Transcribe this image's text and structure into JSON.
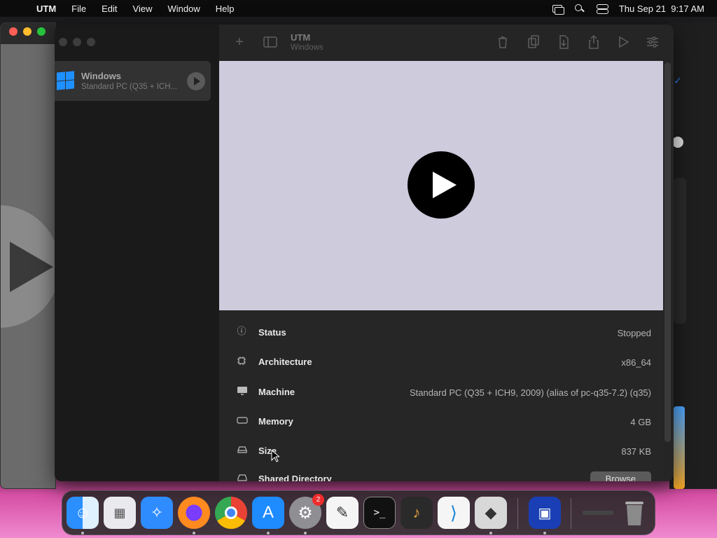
{
  "menubar": {
    "app_name": "UTM",
    "items": [
      "File",
      "Edit",
      "View",
      "Window",
      "Help"
    ],
    "clock": "Thu Sep 21  9:17 AM"
  },
  "sidebar": {
    "vm": {
      "name": "Windows",
      "subtitle": "Standard PC (Q35 + ICH..."
    }
  },
  "toolbar": {
    "title": "UTM",
    "subtitle": "Windows"
  },
  "info": {
    "rows": [
      {
        "label": "Status",
        "value": "Stopped"
      },
      {
        "label": "Architecture",
        "value": "x86_64"
      },
      {
        "label": "Machine",
        "value": "Standard PC (Q35 + ICH9, 2009) (alias of pc-q35-7.2) (q35)"
      },
      {
        "label": "Memory",
        "value": "4 GB"
      },
      {
        "label": "Size",
        "value": "837 KB"
      },
      {
        "label": "Shared Directory",
        "button": "Browse"
      }
    ]
  },
  "dock": {
    "settings_badge": "2"
  },
  "colors": {
    "preview_bg": "#cecbdd",
    "windows_blue": "#1e90ff"
  }
}
